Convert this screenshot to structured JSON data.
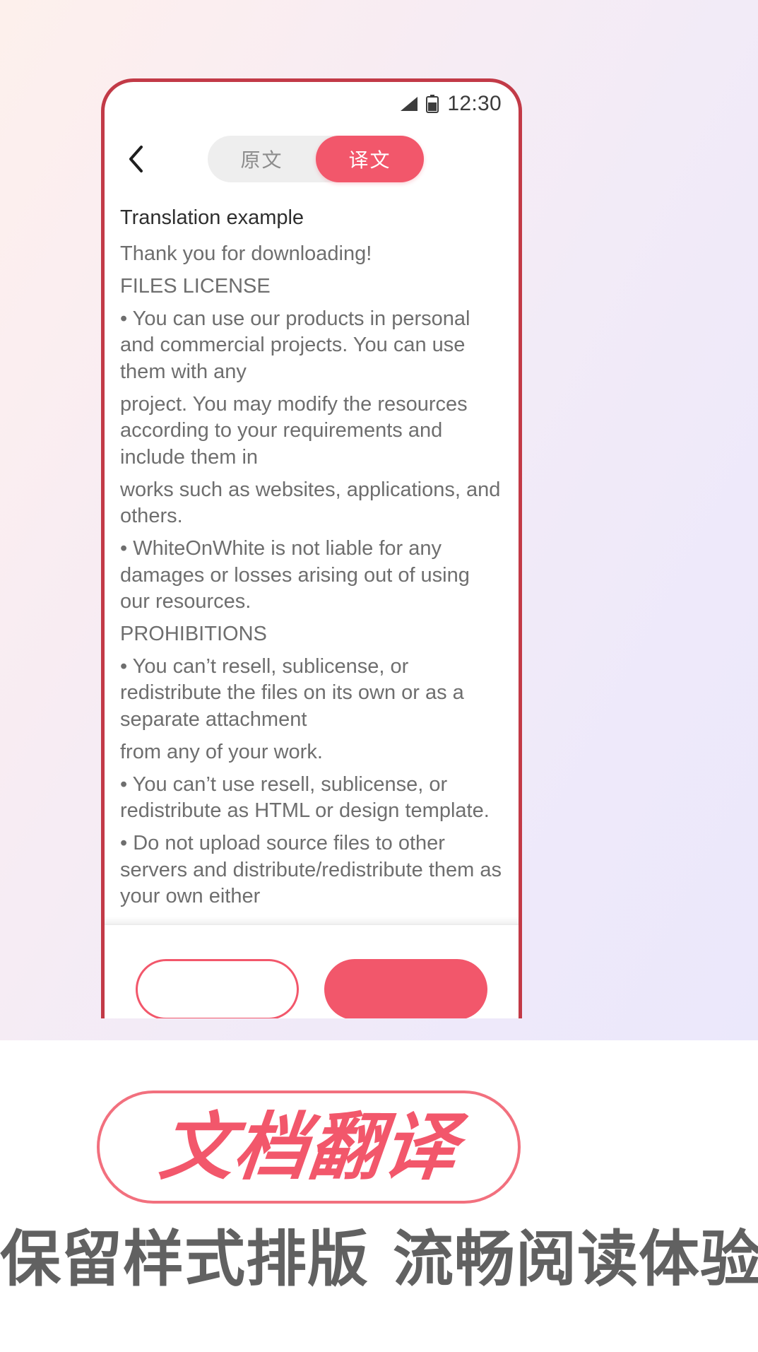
{
  "background": {
    "gradient_start": "#fdf0ec",
    "gradient_end": "#ebe8fb",
    "base": "#ffffff"
  },
  "theme": {
    "accent": "#f2576b",
    "accent_soft": "#f2707e",
    "frame_border": "#c23a47",
    "body_text": "#6e6e6e",
    "title_text": "#2e2e2e",
    "tagline_text": "#616161"
  },
  "phone": {
    "status_bar": {
      "signal_icon": "signal-bars-icon",
      "battery_icon": "battery-icon",
      "time": "12:30"
    },
    "nav": {
      "back_icon": "chevron-left-icon",
      "segmented": {
        "options": [
          {
            "label": "原文",
            "active": false
          },
          {
            "label": "译文",
            "active": true
          }
        ]
      }
    },
    "document": {
      "title": "Translation example",
      "lines": [
        "Thank you for downloading!",
        "FILES LICENSE",
        "• You can use our products in personal and commercial projects. You can use them with any",
        "project. You may modify the resources according to your requirements and include them in",
        "works such as websites, applications, and others.",
        "• WhiteOnWhite is not liable for any damages or losses arising out of using our resources.",
        "PROHIBITIONS",
        "• You can’t resell, sublicense, or redistribute the files on its own or as a separate attachment",
        "from any of your work.",
        "• You can’t use resell, sublicense, or redistribute as HTML or design template.",
        "• Do not upload source files to other servers and distribute/redistribute them as your own either"
      ]
    },
    "actions": {
      "secondary_label": "",
      "primary_label": ""
    }
  },
  "headline": {
    "text": "文档翻译"
  },
  "tagline": {
    "left": "保留样式排版",
    "right": "流畅阅读体验"
  }
}
